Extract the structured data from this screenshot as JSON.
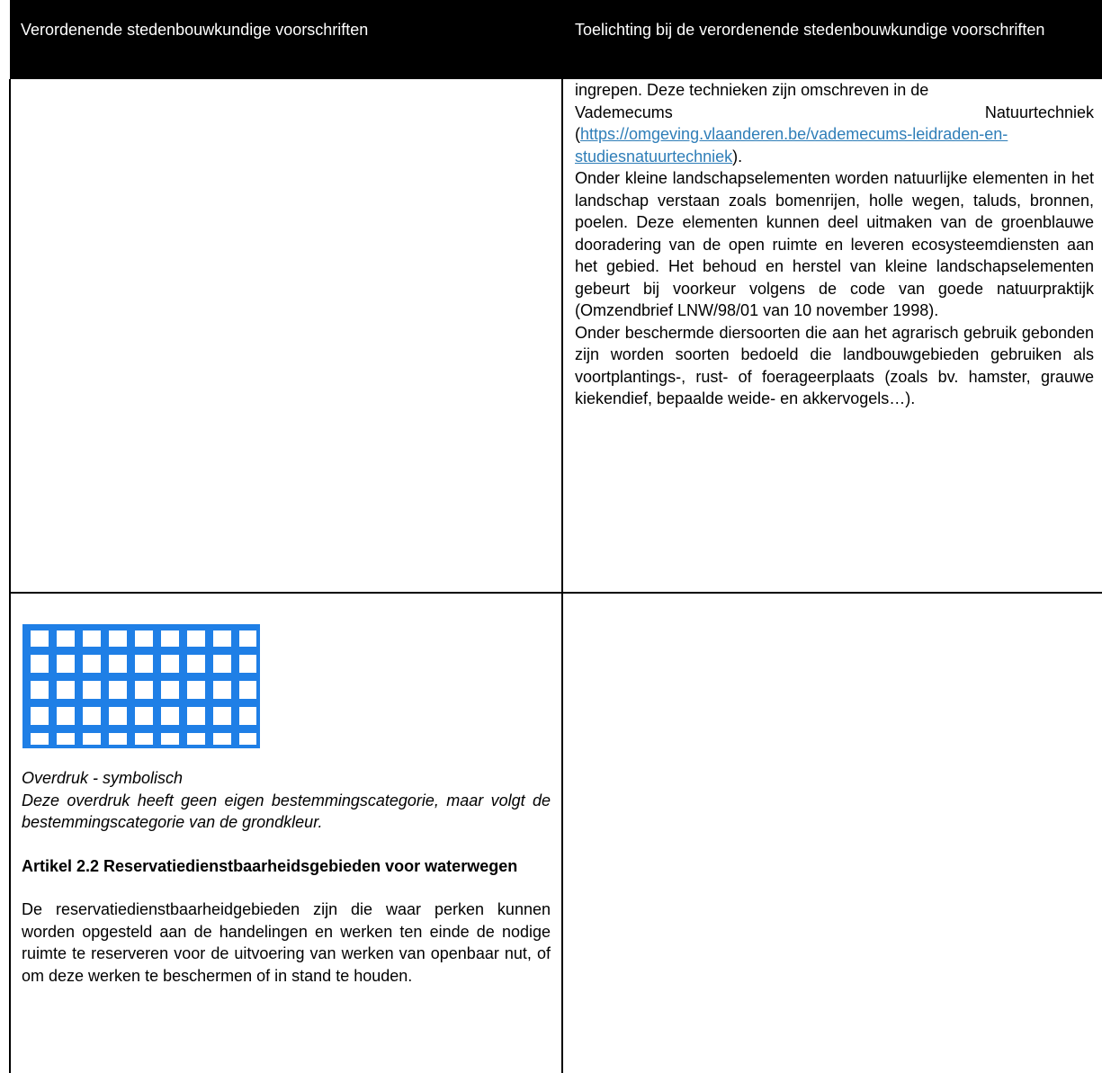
{
  "header": {
    "left": "Verordenende stedenbouwkundige voorschriften",
    "right": "Toelichting bij de verordenende stedenbouwkundige voorschriften"
  },
  "toelichting": {
    "p1_before_link": "ingrepen. Deze technieken zijn omschreven in de",
    "p1_vademecums": "Vademecums",
    "p1_natuurtechniek": "Natuurtechniek",
    "p1_open_paren": "(",
    "p1_link": "https://omgeving.vlaanderen.be/vademecums-leidraden-en-studiesnatuurtechniek",
    "p1_close_paren": ").",
    "p2": "Onder kleine landschapselementen worden natuurlijke elementen in het landschap verstaan zoals bomenrijen, holle wegen, taluds, bronnen, poelen. Deze elementen kunnen deel uitmaken van de groenblauwe dooradering van de open ruimte en leveren ecosysteemdiensten aan het gebied. Het behoud en herstel van kleine landschapselementen gebeurt bij voorkeur volgens de code van goede natuurpraktijk (Omzendbrief LNW/98/01 van 10 november 1998).",
    "p3": "Onder beschermde diersoorten die aan het agrarisch gebruik gebonden zijn worden soorten bedoeld die landbouwgebieden gebruiken als voortplantings-, rust- of foerageerplaats (zoals bv. hamster, grauwe kiekendief, bepaalde weide- en akkervogels…)."
  },
  "legend": {
    "icon": "blue-grid-overdruk-symbol",
    "color": "#1f7fe6",
    "caption_title": "Overdruk - symbolisch",
    "caption_text": "Deze overdruk heeft geen eigen bestemmingscategorie, maar volgt de bestemmingscategorie van de grondkleur."
  },
  "article": {
    "heading": "Artikel 2.2 Reservatiedienstbaarheidsgebieden voor waterwegen",
    "body": "De reservatiedienstbaarheidgebieden zijn die waar perken kunnen worden opgesteld aan de handelingen en werken ten einde de nodige ruimte te reserveren voor de uitvoering van werken van openbaar nut, of om deze werken te beschermen of in stand te houden."
  }
}
